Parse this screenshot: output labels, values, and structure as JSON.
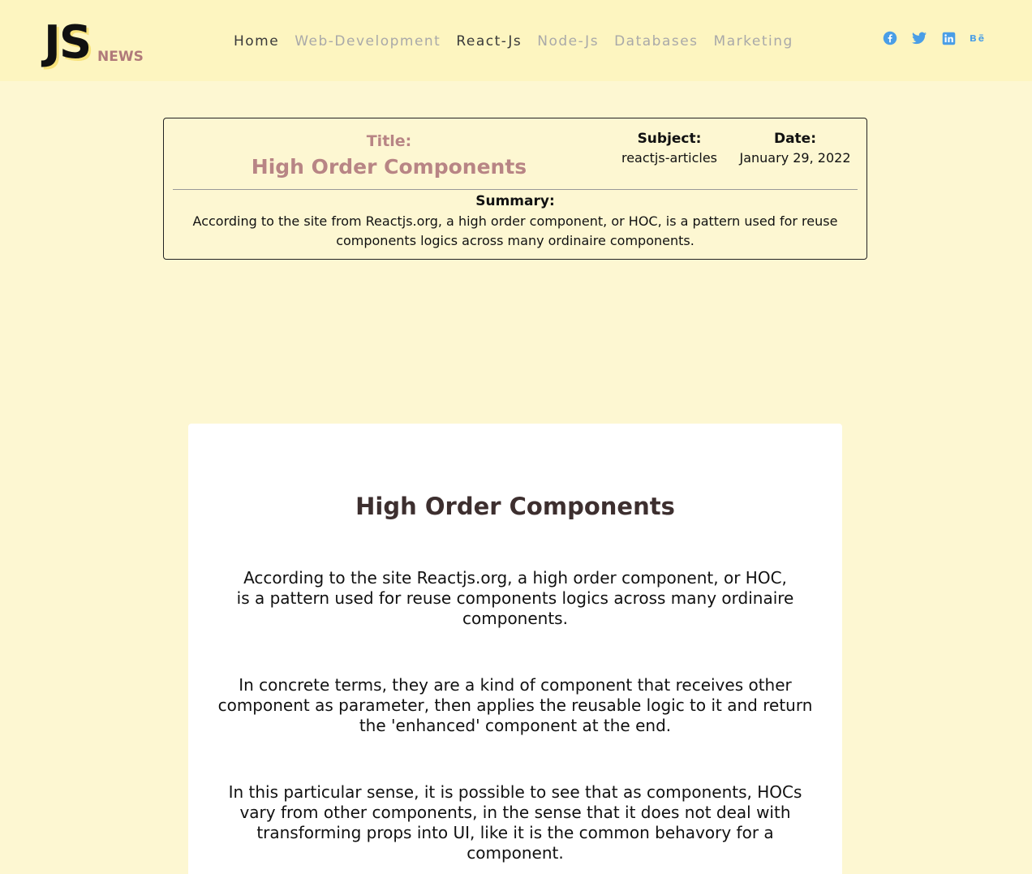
{
  "header": {
    "logo": {
      "main": "JS",
      "sub": "NEWS"
    },
    "nav": [
      {
        "label": "Home"
      },
      {
        "label": "Web-Development"
      },
      {
        "label": "React-Js"
      },
      {
        "label": "Node-Js"
      },
      {
        "label": "Databases"
      },
      {
        "label": "Marketing"
      }
    ],
    "social": [
      {
        "icon": "facebook-icon"
      },
      {
        "icon": "twitter-icon"
      },
      {
        "icon": "linkedin-icon"
      },
      {
        "icon": "behance-icon"
      }
    ],
    "colors": {
      "background": "#fdf5c0",
      "social": "#4a9ee6",
      "nav_active": "#3a3a3a",
      "nav_inactive": "#a9a9a9"
    }
  },
  "info_card": {
    "title_label": "Title:",
    "title": "High Order Components",
    "subject_label": "Subject:",
    "subject": "reactjs-articles",
    "date_label": "Date:",
    "date": "January 29, 2022",
    "summary_label": "Summary:",
    "summary": "According to the site from Reactjs.org, a high order component, or HOC, is a pattern used for reuse components logics across many ordinaire components."
  },
  "article": {
    "title": "High Order Components",
    "paragraphs": [
      "According to the site Reactjs.org, a high order component, or HOC, is a pattern used for reuse components logics across many ordinaire components.",
      "In concrete terms, they are a kind of component that receives other component as parameter, then applies the reusable logic to it and return the 'enhanced' component at the end.",
      "In this particular sense, it is possible to see that as components, HOCs vary from other components, in the sense that it does not deal with transforming props into UI, like it is the common behavory for a component."
    ]
  },
  "colors": {
    "page_background": "#fdf7d2",
    "title_accent": "#b88585",
    "article_background": "#ffffff"
  }
}
